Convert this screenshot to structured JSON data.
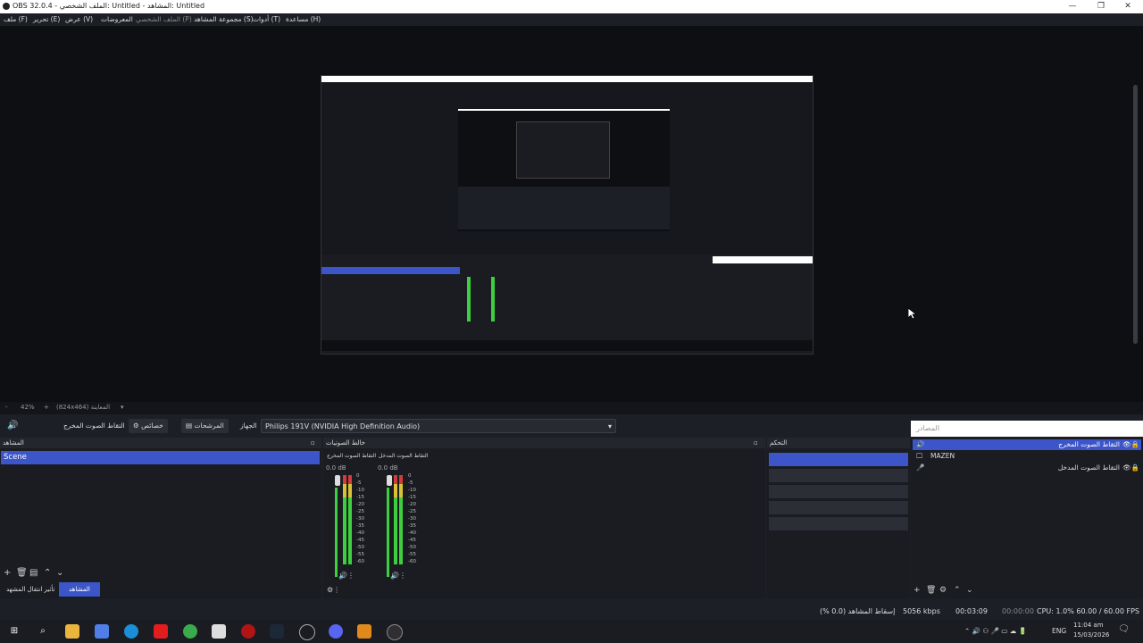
{
  "window": {
    "title": "OBS 32.0.4 - الملف الشخصي: Untitled - المشاهد: Untitled",
    "minimize": "—",
    "maximize": "❐",
    "close": "✕"
  },
  "menu": [
    "ملف (F)",
    "تحرير (E)",
    "عرض (V)",
    "المعروضات",
    "الملف الشخصي (P)",
    "مجموعة المشاهد (S)",
    "أدوات (T)",
    "مساعدة (H)"
  ],
  "zoom": {
    "level": "42%",
    "plus": "+",
    "minus": "-",
    "resolution": "(824x464) المعاينة",
    "dropdown": "▾"
  },
  "audio_toolbar": {
    "source_name": "التقاط الصوت المخرج",
    "properties": "خصائص",
    "filters": "المرشحات",
    "device_label": "الجهاز",
    "device_value": "Philips 191V (NVIDIA High Definition Audio)"
  },
  "docks": {
    "scenes": {
      "title": "المشاهد",
      "item": "Scene"
    },
    "mixer": {
      "title": "خالط الصوتيات",
      "channels": [
        {
          "name": "التقاط الصوت المخرج",
          "db": "0.0 dB"
        },
        {
          "name": "التقاط الصوت المدخل",
          "db": "0.0 dB"
        }
      ],
      "scale": [
        "0",
        "-5",
        "-10",
        "-15",
        "-20",
        "-25",
        "-30",
        "-35",
        "-40",
        "-45",
        "-50",
        "-55",
        "-60"
      ]
    },
    "transitions": {
      "title": "التحكم"
    },
    "sources": {
      "search_placeholder": "المصادر",
      "items": [
        "التقاط الصوت المخرج",
        "MAZEN",
        "التقاط الصوت المدخل"
      ]
    }
  },
  "bottom_tabs": {
    "scene_transitions": "تأثير انتقال المشهد",
    "scenes": "المشاهد"
  },
  "status": {
    "frames": "إسقاط المشاهد (0.0 %)",
    "bitrate": "5056 kbps",
    "rec_time": "00:03:09",
    "stream_time": "00:00:00",
    "cpu": "CPU: 1.0% 60.00 / 60.00 FPS"
  },
  "taskbar": {
    "lang": "ENG",
    "time": "11:04 am",
    "date": "15/03/2026"
  },
  "colors": {
    "accent": "#3c55c8",
    "meter_green": "#3ecf3e",
    "meter_yellow": "#d9c234",
    "meter_red": "#d43b3b"
  }
}
